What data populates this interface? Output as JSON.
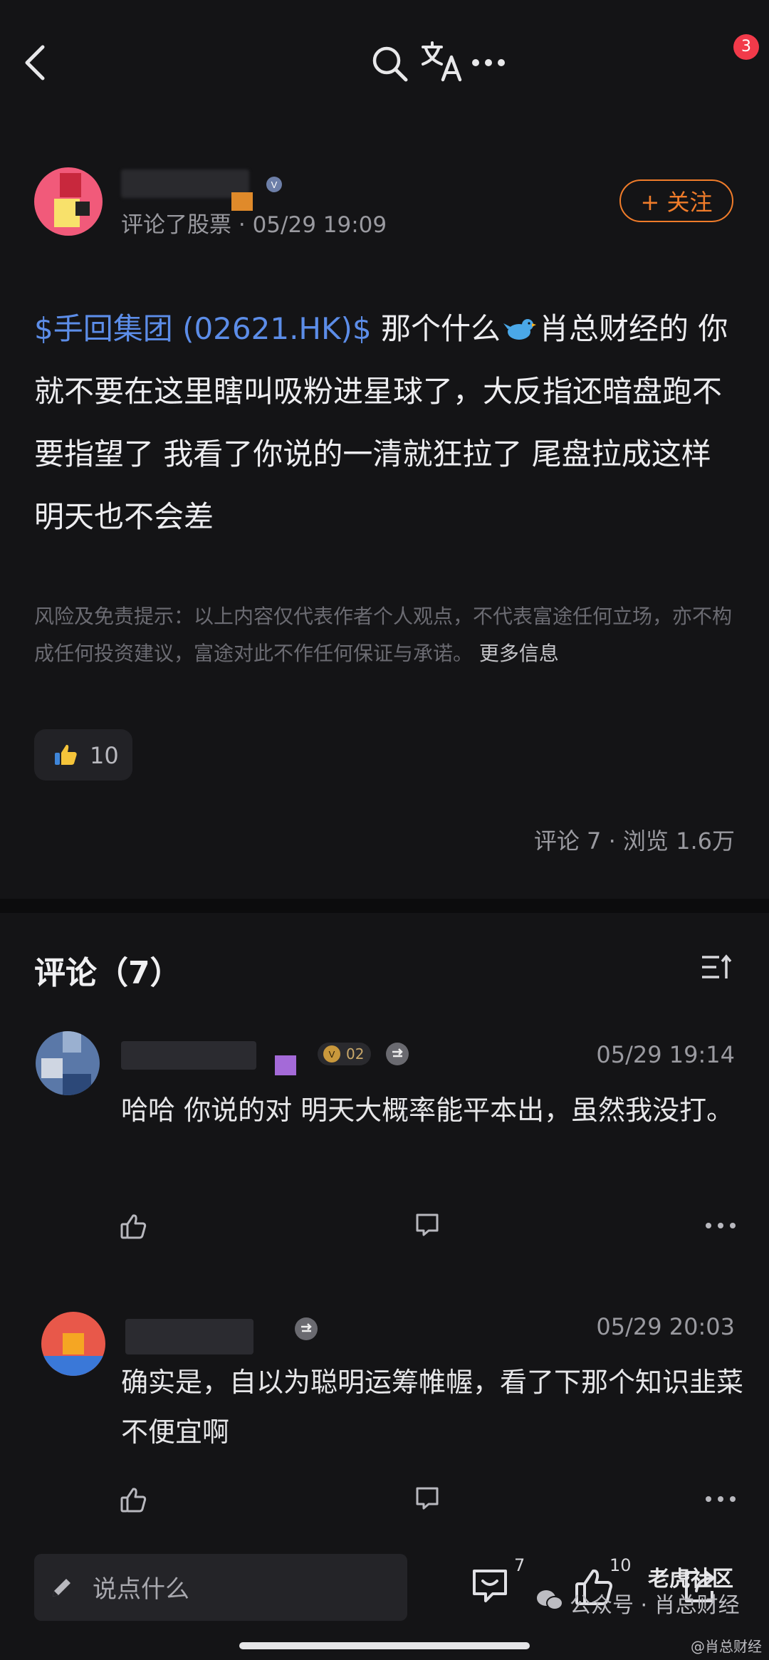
{
  "topbar": {
    "notification_count": "3"
  },
  "author": {
    "action_text": "评论了股票",
    "time": "05/29 19:09",
    "follow_label": "+ 关注"
  },
  "post": {
    "stock_link": "$手回集团 (02621.HK)$",
    "text_before_icon": " 那个什么",
    "bird_icon": "bird-emoji",
    "text_after_icon": "肖总财经的 你就不要在这里瞎叫吸粉进星球了，大反指还暗盘跑不要指望了  我看了你说的一清就狂拉了 尾盘拉成这样明天也不会差",
    "disclaimer": "风险及免责提示：以上内容仅代表作者个人观点，不代表富途任何立场，亦不构成任何投资建议，富途对此不作任何保证与承诺。",
    "more_info_label": "更多信息",
    "like_count": "10",
    "stats": "评论 7 · 浏览 1.6万"
  },
  "comments_section": {
    "title": "评论（7）",
    "items": [
      {
        "badge": "02",
        "time": "05/29 19:14",
        "text": "哈哈 你说的对 明天大概率能平本出，虽然我没打。"
      },
      {
        "time": "05/29 20:03",
        "text": "确实是，自以为聪明运筹帷幄，看了下那个知识韭菜不便宜啊"
      }
    ]
  },
  "bottom_bar": {
    "input_placeholder": "说点什么",
    "comment_count": "7",
    "like_count": "10"
  },
  "watermark": {
    "line1": "公众号 · 肖总财经",
    "line2": "老虎社区",
    "line3": "@肖总财经"
  },
  "colors": {
    "accent": "#f07c2a",
    "link": "#5c8de8",
    "badge": "#f23a4a",
    "background": "#141416"
  }
}
